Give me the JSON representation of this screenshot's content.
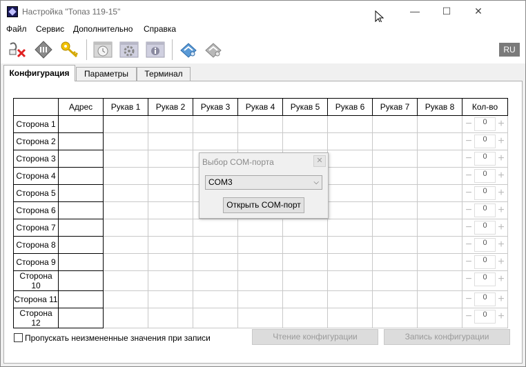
{
  "window": {
    "title": "Настройка \"Топаз 119-15\"",
    "minimize_glyph": "—",
    "maximize_glyph": "☐",
    "close_glyph": "✕"
  },
  "menu": [
    "Файл",
    "Сервис",
    "Дополнительно",
    "Справка"
  ],
  "toolbar": {
    "icons": [
      "disconnect-icon",
      "device-icon",
      "key-icon",
      "clock-icon",
      "settings-icon",
      "info-icon",
      "save-icon",
      "open-icon"
    ],
    "lang_label": "RU"
  },
  "tabs": [
    "Конфигурация",
    "Параметры",
    "Терминал"
  ],
  "active_tab": 0,
  "table": {
    "headers": [
      "Адрес",
      "Рукав 1",
      "Рукав 2",
      "Рукав 3",
      "Рукав 4",
      "Рукав 5",
      "Рукав 6",
      "Рукав 7",
      "Рукав 8",
      "Кол-во"
    ],
    "rows": [
      "Сторона 1",
      "Сторона 2",
      "Сторона 3",
      "Сторона 4",
      "Сторона 5",
      "Сторона 6",
      "Сторона 7",
      "Сторона 8",
      "Сторона 9",
      "Сторона 10",
      "Сторона 11",
      "Сторона 12"
    ],
    "counts": [
      "0",
      "0",
      "0",
      "0",
      "0",
      "0",
      "0",
      "0",
      "0",
      "0",
      "0",
      "0"
    ],
    "minus_glyph": "−",
    "plus_glyph": "+"
  },
  "footer": {
    "skip_unchanged_label": "Пропускать неизмененные значения при записи",
    "skip_unchanged_checked": false,
    "read_config_label": "Чтение конфигурации",
    "write_config_label": "Запись конфигурации"
  },
  "dialog": {
    "title": "Выбор COM-порта",
    "close_glyph": "✕",
    "selected_port": "COM3",
    "chevron_glyph": "⌵",
    "open_button_label": "Открыть COM-порт"
  },
  "colors": {
    "accent_dark": "#1b1b5a",
    "lang_badge": "#7a7a7a",
    "disabled_text": "#9a9a9a"
  }
}
